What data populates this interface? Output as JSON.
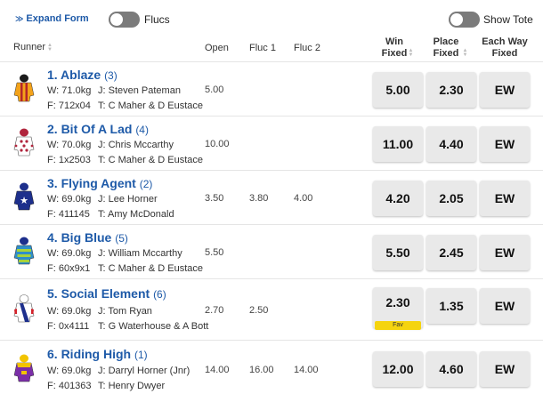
{
  "topbar": {
    "expand_form_label": "Expand Form",
    "flucs_label": "Flucs",
    "show_tote_label": "Show Tote"
  },
  "header": {
    "runner": "Runner",
    "open": "Open",
    "fluc1": "Fluc 1",
    "fluc2": "Fluc 2",
    "win_fixed": [
      "Win",
      "Fixed"
    ],
    "place_fixed": [
      "Place",
      "Fixed"
    ],
    "each_way_fixed": [
      "Each Way",
      "Fixed"
    ]
  },
  "runners": [
    {
      "name": "1. Ablaze",
      "barrier": "(3)",
      "weight": "W: 71.0kg",
      "jockey": "J: Steven Pateman",
      "form": "F: 712x04",
      "trainer": "T: C Maher & D Eustace",
      "open": "5.00",
      "fluc1": "",
      "fluc2": "",
      "win": "5.00",
      "place": "2.30",
      "ew": "EW",
      "fav": ""
    },
    {
      "name": "2. Bit Of A Lad",
      "barrier": "(4)",
      "weight": "W: 70.0kg",
      "jockey": "J: Chris Mccarthy",
      "form": "F: 1x2503",
      "trainer": "T: C Maher & D Eustace",
      "open": "10.00",
      "fluc1": "",
      "fluc2": "",
      "win": "11.00",
      "place": "4.40",
      "ew": "EW",
      "fav": ""
    },
    {
      "name": "3. Flying Agent",
      "barrier": "(2)",
      "weight": "W: 69.0kg",
      "jockey": "J: Lee Horner",
      "form": "F: 411145",
      "trainer": "T: Amy McDonald",
      "open": "3.50",
      "fluc1": "3.80",
      "fluc2": "4.00",
      "win": "4.20",
      "place": "2.05",
      "ew": "EW",
      "fav": ""
    },
    {
      "name": "4. Big Blue",
      "barrier": "(5)",
      "weight": "W: 69.0kg",
      "jockey": "J: William Mccarthy",
      "form": "F: 60x9x1",
      "trainer": "T: C Maher & D Eustace",
      "open": "5.50",
      "fluc1": "",
      "fluc2": "",
      "win": "5.50",
      "place": "2.45",
      "ew": "EW",
      "fav": ""
    },
    {
      "name": "5. Social Element",
      "barrier": "(6)",
      "weight": "W: 69.0kg",
      "jockey": "J: Tom Ryan",
      "form": "F: 0x4111",
      "trainer": "T: G Waterhouse & A Bott",
      "open": "2.70",
      "fluc1": "2.50",
      "fluc2": "",
      "win": "2.30",
      "place": "1.35",
      "ew": "EW",
      "fav": "Fav"
    },
    {
      "name": "6. Riding High",
      "barrier": "(1)",
      "weight": "W: 69.0kg",
      "jockey": "J: Darryl Horner (Jnr)",
      "form": "F: 401363",
      "trainer": "T: Henry Dwyer",
      "open": "14.00",
      "fluc1": "16.00",
      "fluc2": "14.00",
      "win": "12.00",
      "place": "4.60",
      "ew": "EW",
      "fav": ""
    }
  ],
  "silks": [
    {
      "colors": [
        "#f3a21a",
        "#b3262b",
        "#1b1b1b"
      ],
      "pattern": "stripes"
    },
    {
      "colors": [
        "#ffffff",
        "#b0243c",
        "#b0243c"
      ],
      "pattern": "spots"
    },
    {
      "colors": [
        "#1d2f8c",
        "#ffffff",
        "#1d2f8c"
      ],
      "pattern": "stars"
    },
    {
      "colors": [
        "#2e8ec9",
        "#a6d23b",
        "#1d2f8c"
      ],
      "pattern": "hoops"
    },
    {
      "colors": [
        "#ffffff",
        "#d3222a",
        "#1d2f8c"
      ],
      "pattern": "sash"
    },
    {
      "colors": [
        "#7b2ea8",
        "#f2c400",
        "#f2c400"
      ],
      "pattern": "yoke"
    }
  ],
  "colors": {
    "link_blue": "#1e5aa8",
    "button_bg": "#e9e9e9",
    "fav_yellow": "#f5d40f",
    "toggle_off": "#7b7b7b"
  }
}
